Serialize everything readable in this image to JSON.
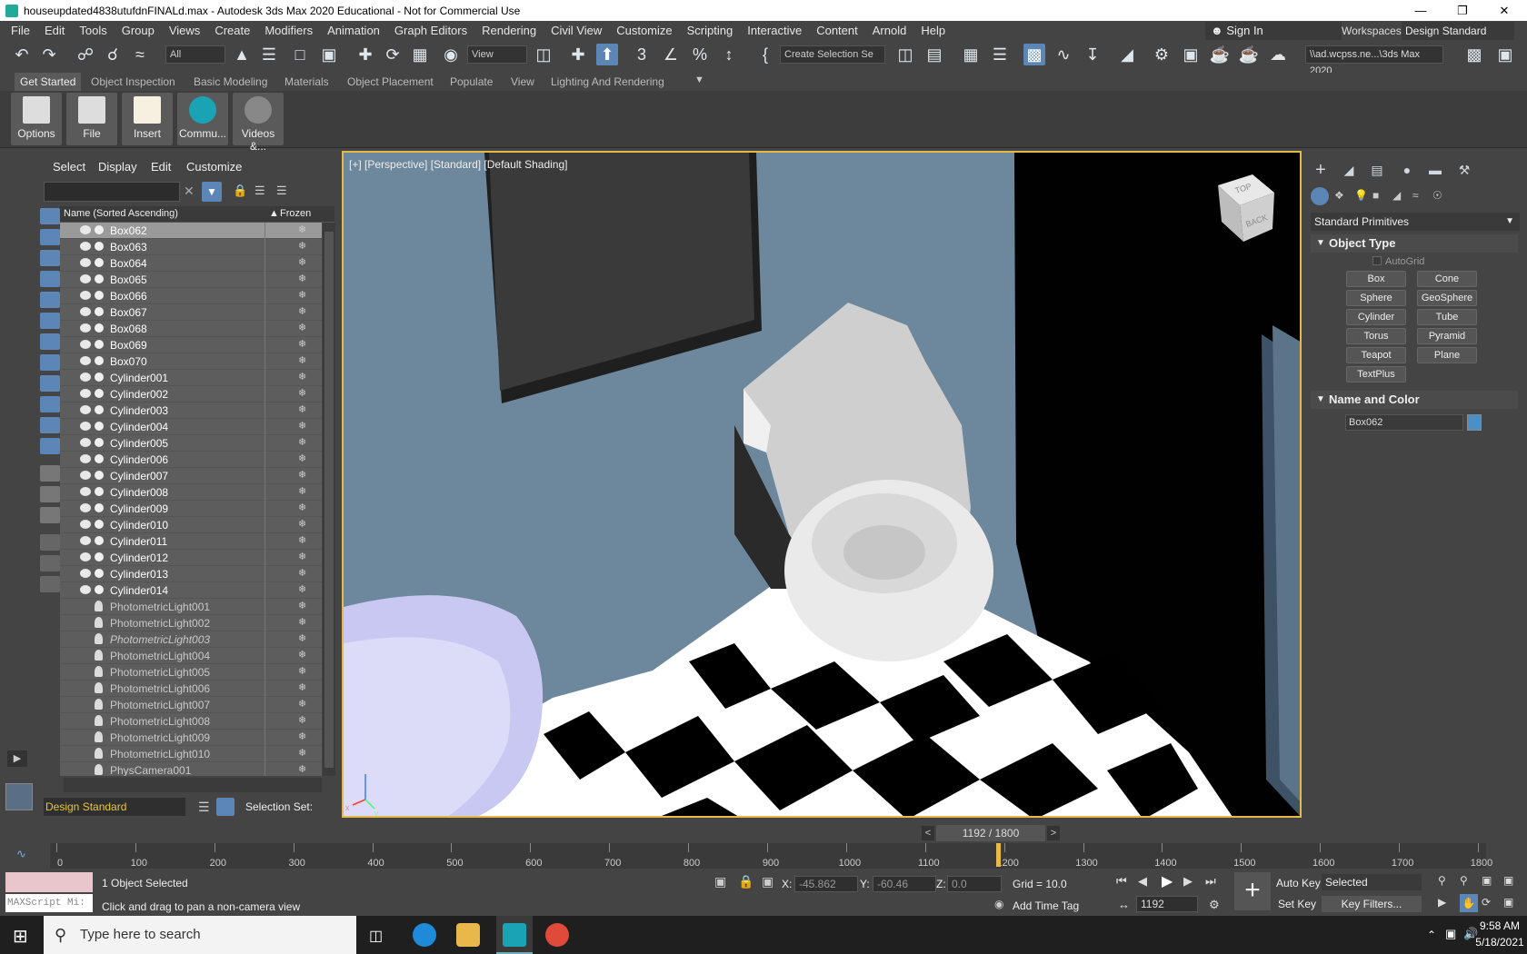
{
  "window": {
    "title": "houseupdated4838utufdnFINALd.max - Autodesk 3ds Max 2020 Educational - Not for Commercial Use"
  },
  "menu": [
    "File",
    "Edit",
    "Tools",
    "Group",
    "Views",
    "Create",
    "Modifiers",
    "Animation",
    "Graph Editors",
    "Rendering",
    "Civil View",
    "Customize",
    "Scripting",
    "Interactive",
    "Content",
    "Arnold",
    "Help"
  ],
  "signin": "Sign In",
  "workspaces": {
    "label": "Workspaces:",
    "value": "Design Standard"
  },
  "toolbar": {
    "filter": "All",
    "refcoord": "View",
    "selection_set": "Create Selection Se",
    "project_path": "\\\\ad.wcpss.ne...\\3ds Max 2020"
  },
  "ribbon": {
    "tabs": [
      "Get Started",
      "Object Inspection",
      "Basic Modeling",
      "Materials",
      "Object Placement",
      "Populate",
      "View",
      "Lighting And Rendering"
    ],
    "buttons": [
      "Options",
      "File",
      "Insert",
      "Commu...",
      "Videos &..."
    ]
  },
  "scene_explorer": {
    "menus": [
      "Select",
      "Display",
      "Edit",
      "Customize"
    ],
    "col_name": "Name (Sorted Ascending)",
    "col_frozen": "Frozen",
    "rows": [
      "Box062",
      "Box063",
      "Box064",
      "Box065",
      "Box066",
      "Box067",
      "Box068",
      "Box069",
      "Box070",
      "Cylinder001",
      "Cylinder002",
      "Cylinder003",
      "Cylinder004",
      "Cylinder005",
      "Cylinder006",
      "Cylinder007",
      "Cylinder008",
      "Cylinder009",
      "Cylinder010",
      "Cylinder011",
      "Cylinder012",
      "Cylinder013",
      "Cylinder014",
      "PhotometricLight001",
      "PhotometricLight002",
      "PhotometricLight003",
      "PhotometricLight004",
      "PhotometricLight005",
      "PhotometricLight006",
      "PhotometricLight007",
      "PhotometricLight008",
      "PhotometricLight009",
      "PhotometricLight010",
      "PhysCamera001"
    ],
    "workspace": "Design Standard",
    "selection_sets": "Selection Set:"
  },
  "viewport": {
    "label": "[+] [Perspective] [Standard] [Default Shading]",
    "viewcube_top": "TOP",
    "viewcube_back": "BACK",
    "axes": [
      "x",
      "y",
      "z"
    ]
  },
  "command_panel": {
    "category": "Standard Primitives",
    "object_type": "Object Type",
    "autogrid": "AutoGrid",
    "buttons": [
      "Box",
      "Cone",
      "Sphere",
      "GeoSphere",
      "Cylinder",
      "Tube",
      "Torus",
      "Pyramid",
      "Teapot",
      "Plane",
      "TextPlus"
    ],
    "name_and_color": "Name and Color",
    "object_name": "Box062",
    "object_color": "#4a90c8"
  },
  "timeline": {
    "frame": "1192 / 1800",
    "ticks": [
      "0",
      "100",
      "200",
      "300",
      "400",
      "500",
      "600",
      "700",
      "800",
      "900",
      "1000",
      "1100",
      "1200",
      "1300",
      "1400",
      "1500",
      "1600",
      "1700",
      "1800"
    ],
    "current": 1192,
    "end": 1800
  },
  "status": {
    "maxscript": "MAXScript Mi:",
    "selected": "1 Object Selected",
    "hint": "Click and drag to pan a non-camera view",
    "x_label": "X:",
    "x": "-45.862",
    "y_label": "Y:",
    "y": "-60.46",
    "z_label": "Z:",
    "z": "0.0",
    "grid": "Grid = 10.0",
    "add_time_tag": "Add Time Tag",
    "frame_field": "1192",
    "auto_key": "Auto Key",
    "set_key": "Set Key",
    "key_mode": "Selected",
    "key_filters": "Key Filters..."
  },
  "taskbar": {
    "search": "Type here to search",
    "time": "9:58 AM",
    "date": "5/18/2021"
  }
}
